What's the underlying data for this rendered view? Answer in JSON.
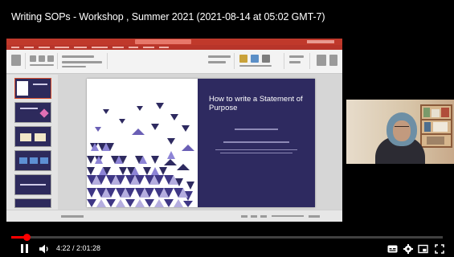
{
  "video": {
    "title": "Writing SOPs - Workshop , Summer 2021 (2021-08-14 at 05:02 GMT-7)"
  },
  "slide": {
    "title": "How to write a Statement of Purpose"
  },
  "player": {
    "current_time": "4:22",
    "duration": "2:01:28",
    "time_display": "4:22 / 2:01:28",
    "progress_fraction": 0.036,
    "state": "playing",
    "icons": [
      "pause-icon",
      "volume-icon",
      "captions-icon",
      "settings-icon",
      "miniplayer-icon",
      "fullscreen-icon"
    ]
  },
  "colors": {
    "accent": "#ff0000",
    "slide_panel": "#2e2a60",
    "ppt_titlebar": "#c0392b"
  }
}
